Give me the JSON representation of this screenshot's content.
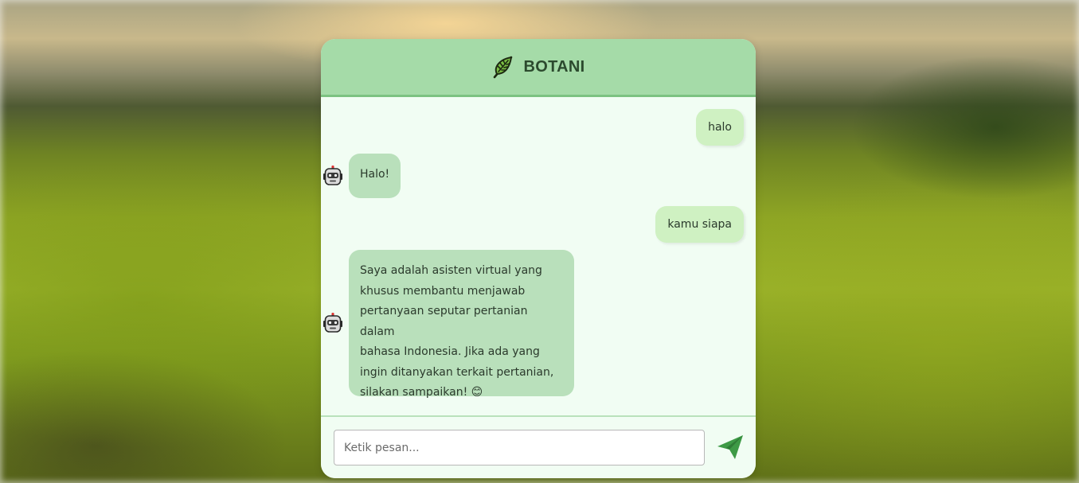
{
  "app": {
    "title": "BOTANI",
    "accent_color": "#a5dba8",
    "header_icon": "leaf-icon"
  },
  "messages": [
    {
      "role": "user",
      "text": "halo"
    },
    {
      "role": "bot",
      "text": "Halo!",
      "avatar": "robot-icon"
    },
    {
      "role": "user",
      "text": "kamu siapa"
    },
    {
      "role": "bot",
      "avatar": "robot-icon",
      "lines": [
        "Saya adalah asisten virtual yang",
        "khusus membantu menjawab",
        "pertanyaan seputar pertanian dalam",
        "bahasa Indonesia. Jika ada yang",
        "ingin ditanyakan terkait pertanian,",
        "silakan sampaikan! 😊"
      ]
    }
  ],
  "composer": {
    "placeholder": "Ketik pesan...",
    "value": "",
    "send_icon": "send-icon"
  }
}
